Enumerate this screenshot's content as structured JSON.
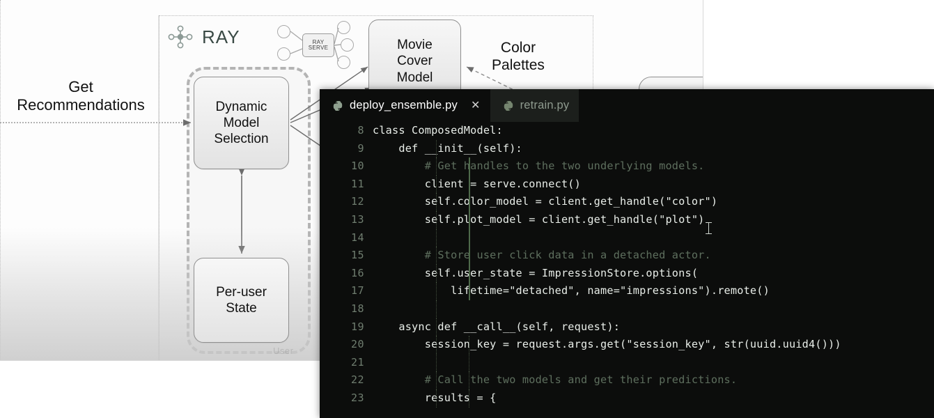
{
  "diagram": {
    "panel_title": "RAY",
    "ray_serve_badge": [
      "RAY",
      "SERVE"
    ],
    "labels": {
      "get_recommendations": "Get\nRecommendations",
      "color_palettes": "Color\nPalettes"
    },
    "nodes": [
      {
        "id": "dynamic-model-selection",
        "label": "Dynamic\nModel\nSelection"
      },
      {
        "id": "per-user-state",
        "label": "Per-user\nState"
      },
      {
        "id": "movie-cover-model",
        "label": "Movie\nCover\nModel"
      }
    ],
    "watermark": "User"
  },
  "editor": {
    "tabs": [
      {
        "label": "deploy_ensemble.py",
        "active": true,
        "closable": true,
        "close_glyph": "✕",
        "icon": "python-file-icon"
      },
      {
        "label": "retrain.py",
        "active": false,
        "closable": false,
        "icon": "python-file-icon"
      }
    ],
    "first_line_number": 8,
    "lines": [
      {
        "num": "8",
        "text": "class ComposedModel:",
        "comment": false,
        "guides": []
      },
      {
        "num": "9",
        "text": "    def __init__(self):",
        "comment": false,
        "guides": [
          "g1"
        ]
      },
      {
        "num": "10",
        "text": "        # Get handles to the two underlying models.",
        "comment": true,
        "guides": [
          "g1",
          "g2-active"
        ]
      },
      {
        "num": "11",
        "text": "        client = serve.connect()",
        "comment": false,
        "guides": [
          "g1",
          "g2-active"
        ]
      },
      {
        "num": "12",
        "text": "        self.color_model = client.get_handle(\"color\")",
        "comment": false,
        "guides": [
          "g1",
          "g2-active"
        ]
      },
      {
        "num": "13",
        "text": "        self.plot_model = client.get_handle(\"plot\")",
        "comment": false,
        "guides": [
          "g1",
          "g2-active"
        ]
      },
      {
        "num": "14",
        "text": "",
        "comment": false,
        "guides": [
          "g1",
          "g2-active"
        ]
      },
      {
        "num": "15",
        "text": "        # Store user click data in a detached actor.",
        "comment": true,
        "guides": [
          "g1",
          "g2-active"
        ]
      },
      {
        "num": "16",
        "text": "        self.user_state = ImpressionStore.options(",
        "comment": false,
        "guides": [
          "g1",
          "g2-active"
        ]
      },
      {
        "num": "17",
        "text": "            lifetime=\"detached\", name=\"impressions\").remote()",
        "comment": false,
        "guides": [
          "g1",
          "g2-active"
        ]
      },
      {
        "num": "18",
        "text": "",
        "comment": false,
        "guides": [
          "g1"
        ]
      },
      {
        "num": "19",
        "text": "    async def __call__(self, request):",
        "comment": false,
        "guides": [
          "g1"
        ]
      },
      {
        "num": "20",
        "text": "        session_key = request.args.get(\"session_key\", str(uuid.uuid4()))",
        "comment": false,
        "guides": [
          "g1",
          "g2"
        ]
      },
      {
        "num": "21",
        "text": "",
        "comment": false,
        "guides": [
          "g1",
          "g2"
        ]
      },
      {
        "num": "22",
        "text": "        # Call the two models and get their predictions.",
        "comment": true,
        "guides": [
          "g1",
          "g2"
        ]
      },
      {
        "num": "23",
        "text": "        results = {",
        "comment": false,
        "guides": [
          "g1",
          "g2"
        ]
      }
    ]
  },
  "colors": {
    "editor_bg": "#0c0d0c",
    "tab_inactive_bg": "#1c1f1c",
    "code_fg": "#e9eee9",
    "comment_fg": "#5e6f5e",
    "gutter_fg": "#6f7d6f",
    "indent_guide": "#44513f",
    "indent_guide_active": "#4e6a4a",
    "diagram_stroke": "#8f8f8f",
    "dashed_stroke": "#b4b4b4",
    "ray_wordmark": "#3a4a45"
  }
}
